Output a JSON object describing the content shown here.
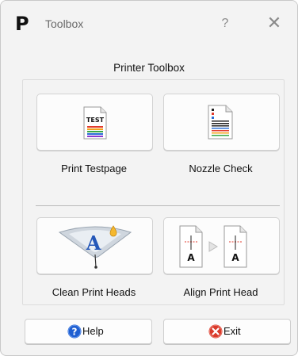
{
  "window": {
    "app_icon_letter": "P",
    "title": "Toolbox",
    "help_glyph": "?",
    "close_glyph": "✕"
  },
  "group": {
    "title": "Printer Toolbox"
  },
  "tools": [
    {
      "label": "Print Testpage",
      "icon": "test-page-icon",
      "icon_text": "TEST"
    },
    {
      "label": "Nozzle Check",
      "icon": "nozzle-check-icon"
    },
    {
      "label": "Clean Print Heads",
      "icon": "clean-heads-icon"
    },
    {
      "label": "Align Print Head",
      "icon": "align-head-icon",
      "icon_text": "A"
    }
  ],
  "buttons": {
    "help": {
      "label": "Help",
      "icon": "help-circle-icon",
      "color": "#1f5fd1"
    },
    "exit": {
      "label": "Exit",
      "icon": "exit-x-icon",
      "color": "#d93a2b"
    }
  }
}
